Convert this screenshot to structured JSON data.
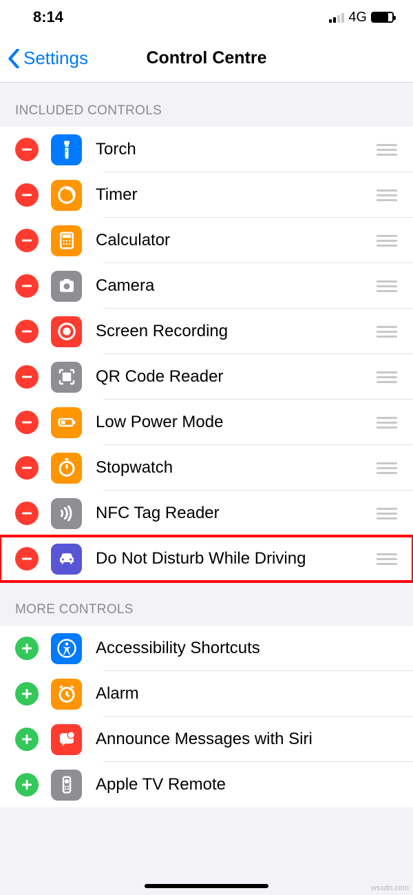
{
  "status": {
    "time": "8:14",
    "network": "4G"
  },
  "nav": {
    "back": "Settings",
    "title": "Control Centre"
  },
  "sections": {
    "included_header": "INCLUDED CONTROLS",
    "more_header": "MORE CONTROLS"
  },
  "included": [
    {
      "id": "torch",
      "label": "Torch"
    },
    {
      "id": "timer",
      "label": "Timer"
    },
    {
      "id": "calculator",
      "label": "Calculator"
    },
    {
      "id": "camera",
      "label": "Camera"
    },
    {
      "id": "screen-recording",
      "label": "Screen Recording"
    },
    {
      "id": "qr-code-reader",
      "label": "QR Code Reader"
    },
    {
      "id": "low-power-mode",
      "label": "Low Power Mode"
    },
    {
      "id": "stopwatch",
      "label": "Stopwatch"
    },
    {
      "id": "nfc-tag-reader",
      "label": "NFC Tag Reader"
    },
    {
      "id": "dnd-driving",
      "label": "Do Not Disturb While Driving",
      "highlight": true
    }
  ],
  "more": [
    {
      "id": "accessibility-shortcuts",
      "label": "Accessibility Shortcuts"
    },
    {
      "id": "alarm",
      "label": "Alarm"
    },
    {
      "id": "announce-messages-siri",
      "label": "Announce Messages with Siri"
    },
    {
      "id": "apple-tv-remote",
      "label": "Apple TV Remote"
    }
  ],
  "watermark": "wsxdn.com"
}
